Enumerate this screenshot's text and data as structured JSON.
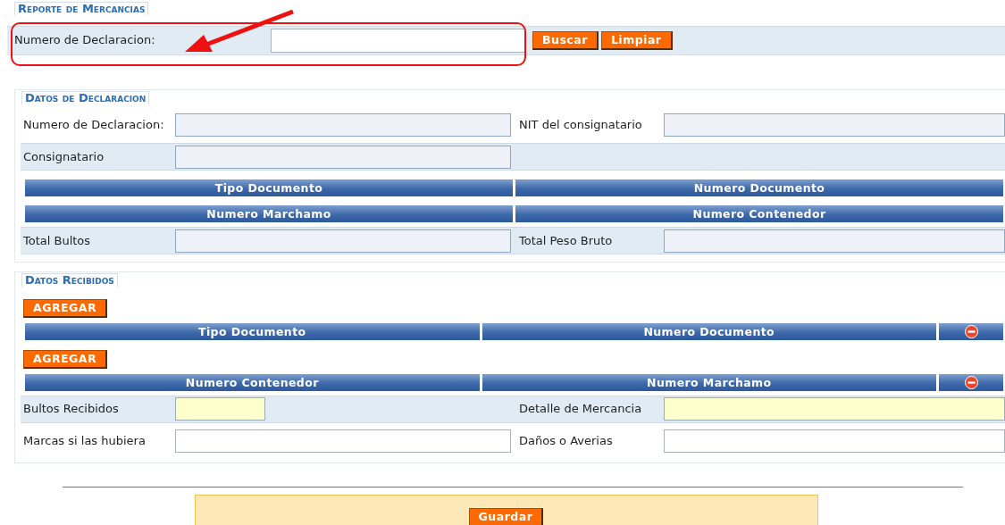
{
  "title": "Reporte de Mercancias",
  "search": {
    "label": "Numero de Declaracion:",
    "buttons": [
      "Buscar",
      "Limpiar"
    ]
  },
  "sections": [
    {
      "title": "Datos de Declaracion",
      "blocks": [
        {
          "kind": "fields",
          "shaded": false,
          "cells": [
            {
              "label": "Numero de Declaracion:",
              "kind": "readonly"
            },
            {
              "label": "NIT del consignatario",
              "kind": "readonly"
            }
          ]
        },
        {
          "kind": "fields",
          "shaded": true,
          "cells": [
            {
              "label": "Consignatario",
              "kind": "readonly"
            }
          ]
        },
        {
          "kind": "header",
          "columns": [
            "Tipo Documento",
            "Numero Documento"
          ],
          "removable": false
        },
        {
          "kind": "header",
          "columns": [
            "Numero Marchamo",
            "Numero Contenedor"
          ],
          "removable": false
        },
        {
          "kind": "fields",
          "shaded": true,
          "cells": [
            {
              "label": "Total Bultos",
              "kind": "readonly"
            },
            {
              "label": "Total Peso Bruto",
              "kind": "readonly"
            }
          ]
        }
      ]
    },
    {
      "title": "Datos Recibidos",
      "blocks": [
        {
          "kind": "button",
          "label": "AGREGAR"
        },
        {
          "kind": "header",
          "columns": [
            "Tipo Documento",
            "Numero Documento"
          ],
          "removable": true
        },
        {
          "kind": "button",
          "label": "AGREGAR"
        },
        {
          "kind": "header",
          "columns": [
            "Numero Contenedor",
            "Numero Marchamo"
          ],
          "removable": true
        },
        {
          "kind": "fields",
          "shaded": true,
          "cells": [
            {
              "label": "Bultos Recibidos",
              "kind": "required",
              "small": true
            },
            {
              "label": "Detalle de Mercancia",
              "kind": "required"
            }
          ]
        },
        {
          "kind": "fields",
          "shaded": false,
          "cells": [
            {
              "label": "Marcas si las hubiera",
              "kind": "input"
            },
            {
              "label": "Daños o Averias",
              "kind": "input"
            }
          ]
        }
      ]
    }
  ],
  "footer": {
    "button": "Guardar"
  }
}
